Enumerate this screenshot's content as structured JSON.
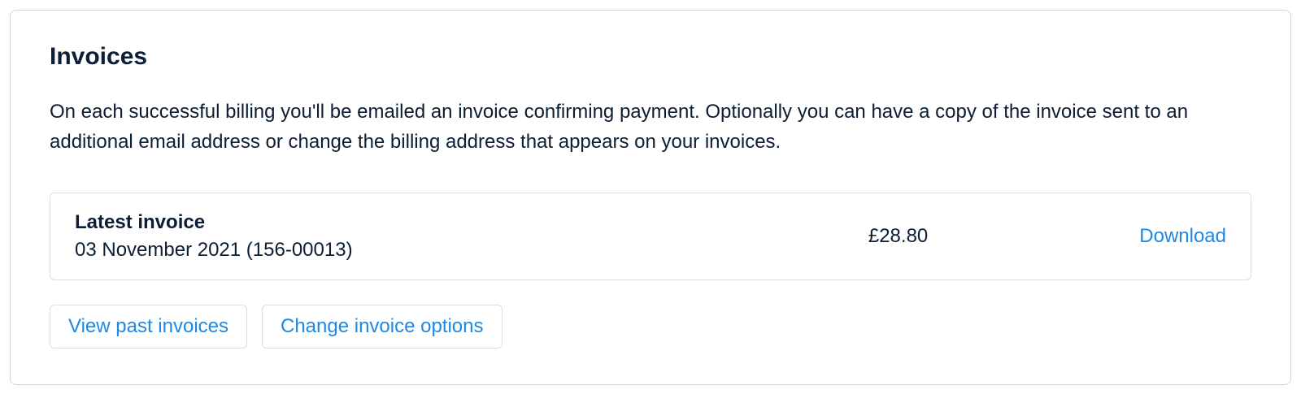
{
  "section": {
    "title": "Invoices",
    "description": "On each successful billing you'll be emailed an invoice confirming payment. Optionally you can have a copy of the invoice sent to an additional email address or change the billing address that appears on your invoices."
  },
  "latest_invoice": {
    "heading": "Latest invoice",
    "date_line": "03 November 2021 (156-00013)",
    "amount": "£28.80",
    "download_label": "Download"
  },
  "actions": {
    "view_past": "View past invoices",
    "change_options": "Change invoice options"
  }
}
